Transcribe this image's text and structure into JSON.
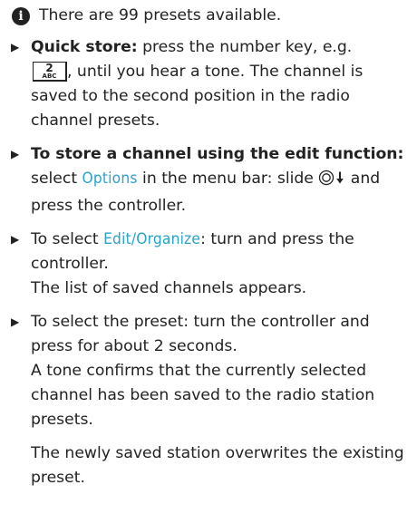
{
  "info": {
    "icon": "info-icon",
    "text": "There are 99 presets available."
  },
  "step1": {
    "label": "Quick store:",
    "text1": " press the number key, e.g.",
    "key_number": "2",
    "key_letters": "ABC",
    "text2": ", until you hear a tone. The channel is saved to the second position in the radio channel presets."
  },
  "step2": {
    "label": "To store a channel using the edit function:",
    "text1": " select ",
    "highlight": "Options",
    "text2": " in the menu bar: slide ",
    "controller_icon": "controller-slide-down-icon",
    "text3": " and press the controller."
  },
  "step3": {
    "text1": "To select ",
    "highlight": "Edit/Organize",
    "text2": ": turn and press the controller.",
    "result": "The list of saved channels appears."
  },
  "step4": {
    "text1": "To select the preset: turn the controller and press for about 2 seconds.",
    "result": "A tone confirms that the currently selected channel has been saved to the radio station presets."
  },
  "note": "The newly saved station overwrites the existing preset.",
  "colors": {
    "highlight": "#2aa3c9",
    "text": "#222222"
  }
}
